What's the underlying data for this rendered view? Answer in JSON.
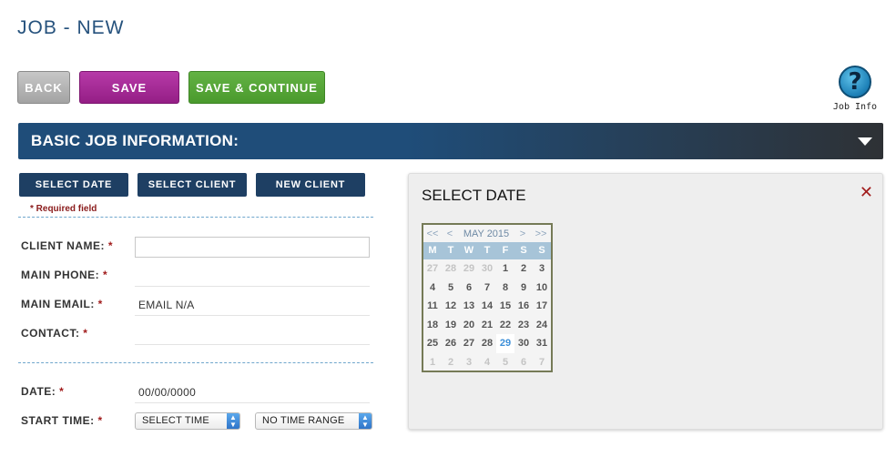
{
  "page": {
    "title": "JOB - NEW"
  },
  "toolbar": {
    "back_label": "BACK",
    "save_label": "SAVE",
    "save_continue_label": "SAVE & CONTINUE"
  },
  "help": {
    "label": "Job Info",
    "icon": "help-question-icon"
  },
  "section": {
    "title": "BASIC JOB INFORMATION:",
    "toggle_icon": "caret-down-icon"
  },
  "actions": {
    "select_date": "SELECT DATE",
    "select_client": "SELECT CLIENT",
    "new_client": "NEW CLIENT"
  },
  "form": {
    "required_note": "* Required field",
    "client_name_label": "CLIENT NAME:",
    "client_name_value": "",
    "main_phone_label": "MAIN PHONE:",
    "main_email_label": "MAIN EMAIL:",
    "main_email_value": "EMAIL N/A",
    "contact_label": "CONTACT:",
    "date_label": "DATE:",
    "date_value": "00/00/0000",
    "start_time_label": "START TIME:",
    "start_time_select": "SELECT TIME",
    "time_range_select": "NO TIME RANGE",
    "required_star": "*"
  },
  "date_panel": {
    "title": "SELECT DATE",
    "close_icon": "✕",
    "nav": {
      "prev_year": "<<",
      "prev_month": "<",
      "next_month": ">",
      "next_year": ">>"
    },
    "month_label": "MAY 2015",
    "weekdays": [
      "M",
      "T",
      "W",
      "T",
      "F",
      "S",
      "S"
    ],
    "days": [
      {
        "d": "27",
        "muted": true
      },
      {
        "d": "28",
        "muted": true
      },
      {
        "d": "29",
        "muted": true
      },
      {
        "d": "30",
        "muted": true
      },
      {
        "d": "1"
      },
      {
        "d": "2"
      },
      {
        "d": "3"
      },
      {
        "d": "4"
      },
      {
        "d": "5"
      },
      {
        "d": "6"
      },
      {
        "d": "7"
      },
      {
        "d": "8"
      },
      {
        "d": "9"
      },
      {
        "d": "10"
      },
      {
        "d": "11"
      },
      {
        "d": "12"
      },
      {
        "d": "13"
      },
      {
        "d": "14"
      },
      {
        "d": "15"
      },
      {
        "d": "16"
      },
      {
        "d": "17"
      },
      {
        "d": "18"
      },
      {
        "d": "19"
      },
      {
        "d": "20"
      },
      {
        "d": "21"
      },
      {
        "d": "22"
      },
      {
        "d": "23"
      },
      {
        "d": "24"
      },
      {
        "d": "25"
      },
      {
        "d": "26"
      },
      {
        "d": "27"
      },
      {
        "d": "28"
      },
      {
        "d": "29",
        "today": true
      },
      {
        "d": "30"
      },
      {
        "d": "31"
      },
      {
        "d": "1",
        "muted": true
      },
      {
        "d": "2",
        "muted": true
      },
      {
        "d": "3",
        "muted": true
      },
      {
        "d": "4",
        "muted": true
      },
      {
        "d": "5",
        "muted": true
      },
      {
        "d": "6",
        "muted": true
      },
      {
        "d": "7",
        "muted": true
      }
    ]
  },
  "colors": {
    "primary": "#1f4d79",
    "save": "#a82b99",
    "save_continue": "#55a636",
    "back": "#b0b0b0",
    "required": "#a11c1c",
    "today": "#3d8fd8"
  }
}
